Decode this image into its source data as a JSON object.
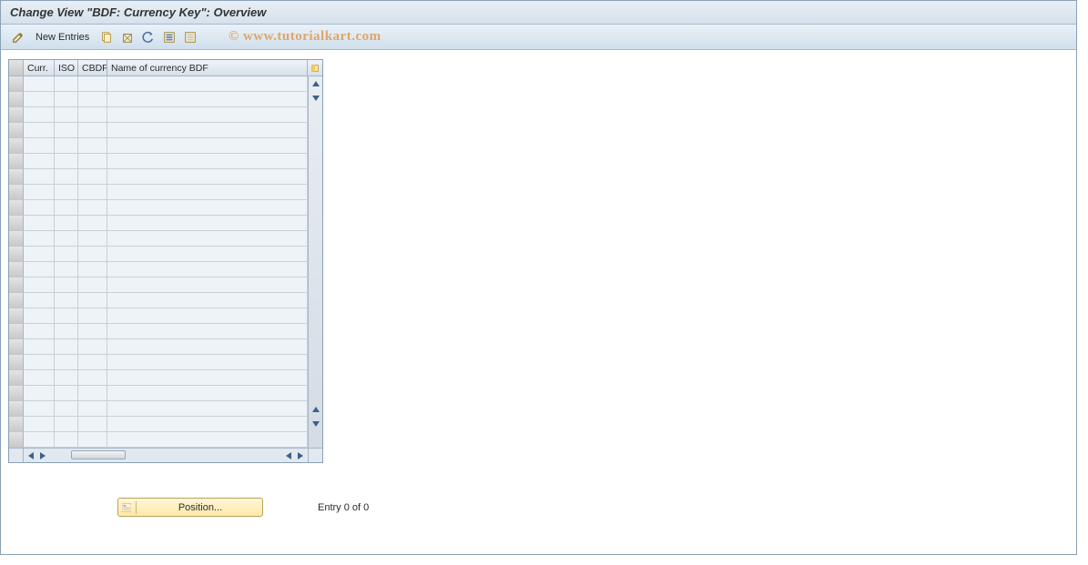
{
  "title": "Change View \"BDF: Currency Key\": Overview",
  "toolbar": {
    "new_entries": "New Entries"
  },
  "watermark": "© www.tutorialkart.com",
  "table": {
    "headers": {
      "curr": "Curr.",
      "iso": "ISO",
      "cbdf": "CBDF",
      "name": "Name of currency BDF"
    },
    "rows": [
      {
        "curr": "",
        "iso": "",
        "cbdf": "",
        "name": ""
      },
      {
        "curr": "",
        "iso": "",
        "cbdf": "",
        "name": ""
      },
      {
        "curr": "",
        "iso": "",
        "cbdf": "",
        "name": ""
      },
      {
        "curr": "",
        "iso": "",
        "cbdf": "",
        "name": ""
      },
      {
        "curr": "",
        "iso": "",
        "cbdf": "",
        "name": ""
      },
      {
        "curr": "",
        "iso": "",
        "cbdf": "",
        "name": ""
      },
      {
        "curr": "",
        "iso": "",
        "cbdf": "",
        "name": ""
      },
      {
        "curr": "",
        "iso": "",
        "cbdf": "",
        "name": ""
      },
      {
        "curr": "",
        "iso": "",
        "cbdf": "",
        "name": ""
      },
      {
        "curr": "",
        "iso": "",
        "cbdf": "",
        "name": ""
      },
      {
        "curr": "",
        "iso": "",
        "cbdf": "",
        "name": ""
      },
      {
        "curr": "",
        "iso": "",
        "cbdf": "",
        "name": ""
      },
      {
        "curr": "",
        "iso": "",
        "cbdf": "",
        "name": ""
      },
      {
        "curr": "",
        "iso": "",
        "cbdf": "",
        "name": ""
      },
      {
        "curr": "",
        "iso": "",
        "cbdf": "",
        "name": ""
      },
      {
        "curr": "",
        "iso": "",
        "cbdf": "",
        "name": ""
      },
      {
        "curr": "",
        "iso": "",
        "cbdf": "",
        "name": ""
      },
      {
        "curr": "",
        "iso": "",
        "cbdf": "",
        "name": ""
      },
      {
        "curr": "",
        "iso": "",
        "cbdf": "",
        "name": ""
      },
      {
        "curr": "",
        "iso": "",
        "cbdf": "",
        "name": ""
      },
      {
        "curr": "",
        "iso": "",
        "cbdf": "",
        "name": ""
      },
      {
        "curr": "",
        "iso": "",
        "cbdf": "",
        "name": ""
      },
      {
        "curr": "",
        "iso": "",
        "cbdf": "",
        "name": ""
      },
      {
        "curr": "",
        "iso": "",
        "cbdf": "",
        "name": ""
      }
    ]
  },
  "position_label": "Position...",
  "entry_status": "Entry 0 of 0"
}
